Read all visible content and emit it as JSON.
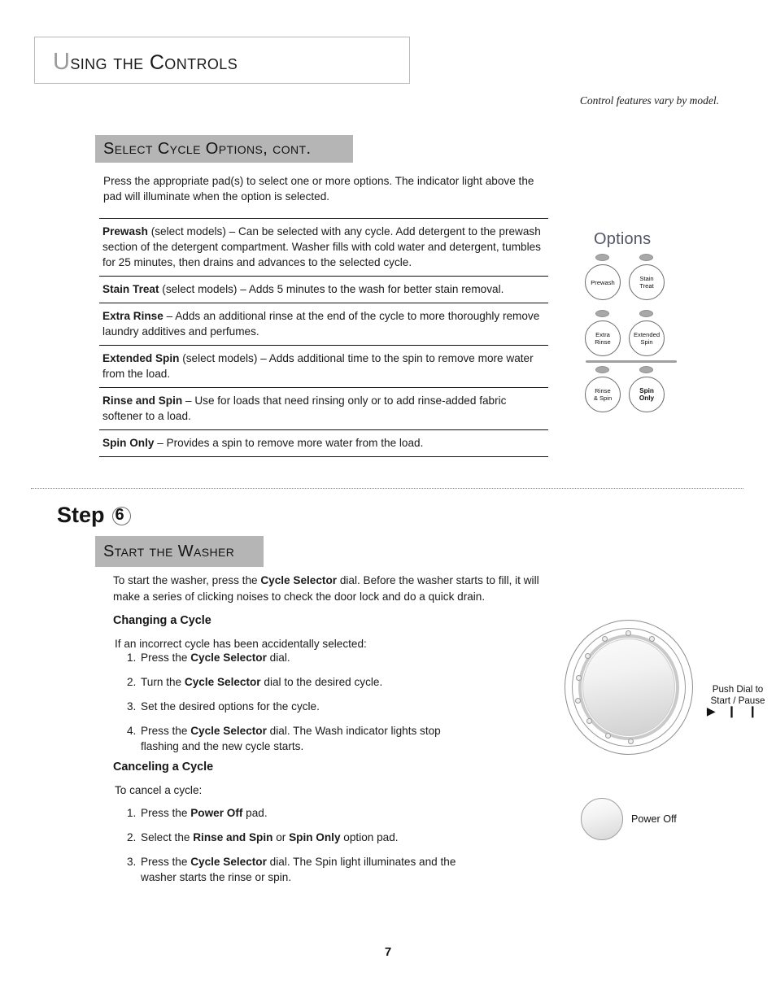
{
  "page": {
    "title": "Using the Controls",
    "title_first_letter": "U",
    "title_rest": "sing the Controls",
    "model_note": "Control features vary by model.",
    "page_number": "7"
  },
  "select_cycle_options": {
    "band_label": "Select Cycle Options, cont.",
    "intro": "Press the appropriate pad(s) to select one or more options. The indicator light above the pad will illuminate when the option is selected.",
    "entries": [
      {
        "term": "Prewash",
        "qualifier": " (select models) – ",
        "description": "Can be selected with any cycle. Add detergent to the prewash section of the detergent compartment. Washer fills with cold water and detergent, tumbles for 25 minutes, then drains and advances to the selected cycle."
      },
      {
        "term": "Stain Treat",
        "qualifier": " (select models) – ",
        "description": "Adds 5 minutes to the wash for better stain removal."
      },
      {
        "term": "Extra Rinse",
        "qualifier": " – ",
        "description": "Adds an additional rinse at the end of the cycle to more thoroughly remove laundry additives and perfumes."
      },
      {
        "term": "Extended Spin",
        "qualifier": " (select models) – ",
        "description": "Adds additional time to the spin to remove more water from the load."
      },
      {
        "term": "Rinse and Spin",
        "qualifier": " – ",
        "description": "Use for loads that need rinsing only or to add rinse-added fabric softener to a load."
      },
      {
        "term": "Spin Only",
        "qualifier": " – ",
        "description": "Provides a spin to remove more water from the load."
      }
    ]
  },
  "options_panel": {
    "title": "Options",
    "buttons": [
      {
        "label_line1": "Prewash",
        "label_line2": ""
      },
      {
        "label_line1": "Stain",
        "label_line2": "Treat"
      },
      {
        "label_line1": "Extra",
        "label_line2": "Rinse"
      },
      {
        "label_line1": "Extended",
        "label_line2": "Spin"
      },
      {
        "label_line1": "Rinse",
        "label_line2": "& Spin"
      },
      {
        "label_line1": "Spin",
        "label_line2": "Only"
      }
    ]
  },
  "step6": {
    "step_word": "Step",
    "step_number": "6",
    "band_label": "Start the Washer",
    "intro": "To start the washer, press the Cycle Selector dial. Before the washer starts to fill, it will make a series of clicking noises to check the door lock and do a quick drain.",
    "changing": {
      "heading": "Changing a Cycle",
      "lead": "If an incorrect cycle has been accidentally selected:",
      "items": [
        {
          "num": "1.",
          "text": "Press the Cycle Selector dial."
        },
        {
          "num": "2.",
          "text": "Turn the Cycle Selector dial to the desired cycle."
        },
        {
          "num": "3.",
          "text": "Set the desired options for the cycle."
        },
        {
          "num": "4.",
          "text": "Press the Cycle Selector dial. The Wash indicator lights stop flashing and the new cycle starts."
        }
      ]
    },
    "canceling": {
      "heading": "Canceling a Cycle",
      "lead": "To cancel a cycle:",
      "items": [
        {
          "num": "1.",
          "text": "Press the Power Off pad."
        },
        {
          "num": "2.",
          "text": "Select the Rinse and Spin or Spin Only option pad."
        },
        {
          "num": "3.",
          "text": "Press the Cycle Selector dial. The Spin light illuminates and the washer starts the rinse or spin."
        }
      ]
    }
  },
  "dial": {
    "caption_line1": "Push Dial to",
    "caption_line2": "Start / Pause",
    "play_glyph": "▶",
    "pause_glyph": "❙❙"
  },
  "power_off": {
    "label": "Power Off"
  },
  "colors": {
    "band_gray": "#b5b5b5",
    "options_title": "#51566b",
    "rule_black": "#111111",
    "led_gray": "#a8a8a8"
  }
}
